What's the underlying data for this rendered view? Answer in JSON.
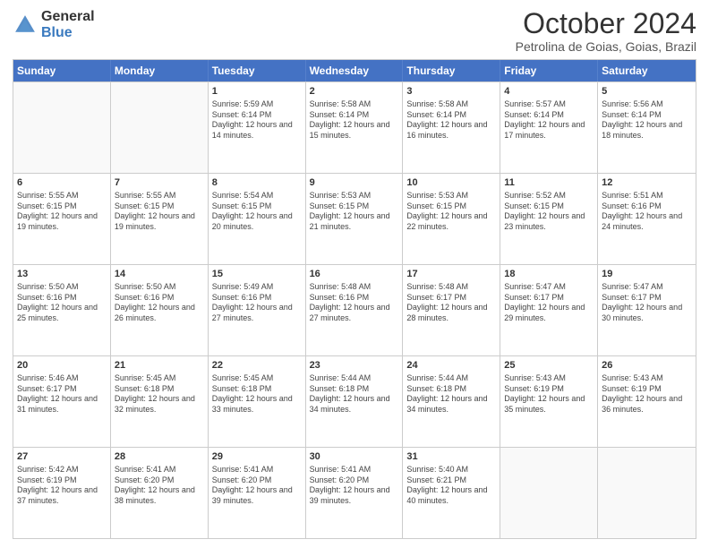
{
  "logo": {
    "general": "General",
    "blue": "Blue"
  },
  "header": {
    "month": "October 2024",
    "location": "Petrolina de Goias, Goias, Brazil"
  },
  "days": [
    "Sunday",
    "Monday",
    "Tuesday",
    "Wednesday",
    "Thursday",
    "Friday",
    "Saturday"
  ],
  "weeks": [
    [
      {
        "day": "",
        "info": ""
      },
      {
        "day": "",
        "info": ""
      },
      {
        "day": "1",
        "info": "Sunrise: 5:59 AM\nSunset: 6:14 PM\nDaylight: 12 hours and 14 minutes."
      },
      {
        "day": "2",
        "info": "Sunrise: 5:58 AM\nSunset: 6:14 PM\nDaylight: 12 hours and 15 minutes."
      },
      {
        "day": "3",
        "info": "Sunrise: 5:58 AM\nSunset: 6:14 PM\nDaylight: 12 hours and 16 minutes."
      },
      {
        "day": "4",
        "info": "Sunrise: 5:57 AM\nSunset: 6:14 PM\nDaylight: 12 hours and 17 minutes."
      },
      {
        "day": "5",
        "info": "Sunrise: 5:56 AM\nSunset: 6:14 PM\nDaylight: 12 hours and 18 minutes."
      }
    ],
    [
      {
        "day": "6",
        "info": "Sunrise: 5:55 AM\nSunset: 6:15 PM\nDaylight: 12 hours and 19 minutes."
      },
      {
        "day": "7",
        "info": "Sunrise: 5:55 AM\nSunset: 6:15 PM\nDaylight: 12 hours and 19 minutes."
      },
      {
        "day": "8",
        "info": "Sunrise: 5:54 AM\nSunset: 6:15 PM\nDaylight: 12 hours and 20 minutes."
      },
      {
        "day": "9",
        "info": "Sunrise: 5:53 AM\nSunset: 6:15 PM\nDaylight: 12 hours and 21 minutes."
      },
      {
        "day": "10",
        "info": "Sunrise: 5:53 AM\nSunset: 6:15 PM\nDaylight: 12 hours and 22 minutes."
      },
      {
        "day": "11",
        "info": "Sunrise: 5:52 AM\nSunset: 6:15 PM\nDaylight: 12 hours and 23 minutes."
      },
      {
        "day": "12",
        "info": "Sunrise: 5:51 AM\nSunset: 6:16 PM\nDaylight: 12 hours and 24 minutes."
      }
    ],
    [
      {
        "day": "13",
        "info": "Sunrise: 5:50 AM\nSunset: 6:16 PM\nDaylight: 12 hours and 25 minutes."
      },
      {
        "day": "14",
        "info": "Sunrise: 5:50 AM\nSunset: 6:16 PM\nDaylight: 12 hours and 26 minutes."
      },
      {
        "day": "15",
        "info": "Sunrise: 5:49 AM\nSunset: 6:16 PM\nDaylight: 12 hours and 27 minutes."
      },
      {
        "day": "16",
        "info": "Sunrise: 5:48 AM\nSunset: 6:16 PM\nDaylight: 12 hours and 27 minutes."
      },
      {
        "day": "17",
        "info": "Sunrise: 5:48 AM\nSunset: 6:17 PM\nDaylight: 12 hours and 28 minutes."
      },
      {
        "day": "18",
        "info": "Sunrise: 5:47 AM\nSunset: 6:17 PM\nDaylight: 12 hours and 29 minutes."
      },
      {
        "day": "19",
        "info": "Sunrise: 5:47 AM\nSunset: 6:17 PM\nDaylight: 12 hours and 30 minutes."
      }
    ],
    [
      {
        "day": "20",
        "info": "Sunrise: 5:46 AM\nSunset: 6:17 PM\nDaylight: 12 hours and 31 minutes."
      },
      {
        "day": "21",
        "info": "Sunrise: 5:45 AM\nSunset: 6:18 PM\nDaylight: 12 hours and 32 minutes."
      },
      {
        "day": "22",
        "info": "Sunrise: 5:45 AM\nSunset: 6:18 PM\nDaylight: 12 hours and 33 minutes."
      },
      {
        "day": "23",
        "info": "Sunrise: 5:44 AM\nSunset: 6:18 PM\nDaylight: 12 hours and 34 minutes."
      },
      {
        "day": "24",
        "info": "Sunrise: 5:44 AM\nSunset: 6:18 PM\nDaylight: 12 hours and 34 minutes."
      },
      {
        "day": "25",
        "info": "Sunrise: 5:43 AM\nSunset: 6:19 PM\nDaylight: 12 hours and 35 minutes."
      },
      {
        "day": "26",
        "info": "Sunrise: 5:43 AM\nSunset: 6:19 PM\nDaylight: 12 hours and 36 minutes."
      }
    ],
    [
      {
        "day": "27",
        "info": "Sunrise: 5:42 AM\nSunset: 6:19 PM\nDaylight: 12 hours and 37 minutes."
      },
      {
        "day": "28",
        "info": "Sunrise: 5:41 AM\nSunset: 6:20 PM\nDaylight: 12 hours and 38 minutes."
      },
      {
        "day": "29",
        "info": "Sunrise: 5:41 AM\nSunset: 6:20 PM\nDaylight: 12 hours and 39 minutes."
      },
      {
        "day": "30",
        "info": "Sunrise: 5:41 AM\nSunset: 6:20 PM\nDaylight: 12 hours and 39 minutes."
      },
      {
        "day": "31",
        "info": "Sunrise: 5:40 AM\nSunset: 6:21 PM\nDaylight: 12 hours and 40 minutes."
      },
      {
        "day": "",
        "info": ""
      },
      {
        "day": "",
        "info": ""
      }
    ]
  ]
}
